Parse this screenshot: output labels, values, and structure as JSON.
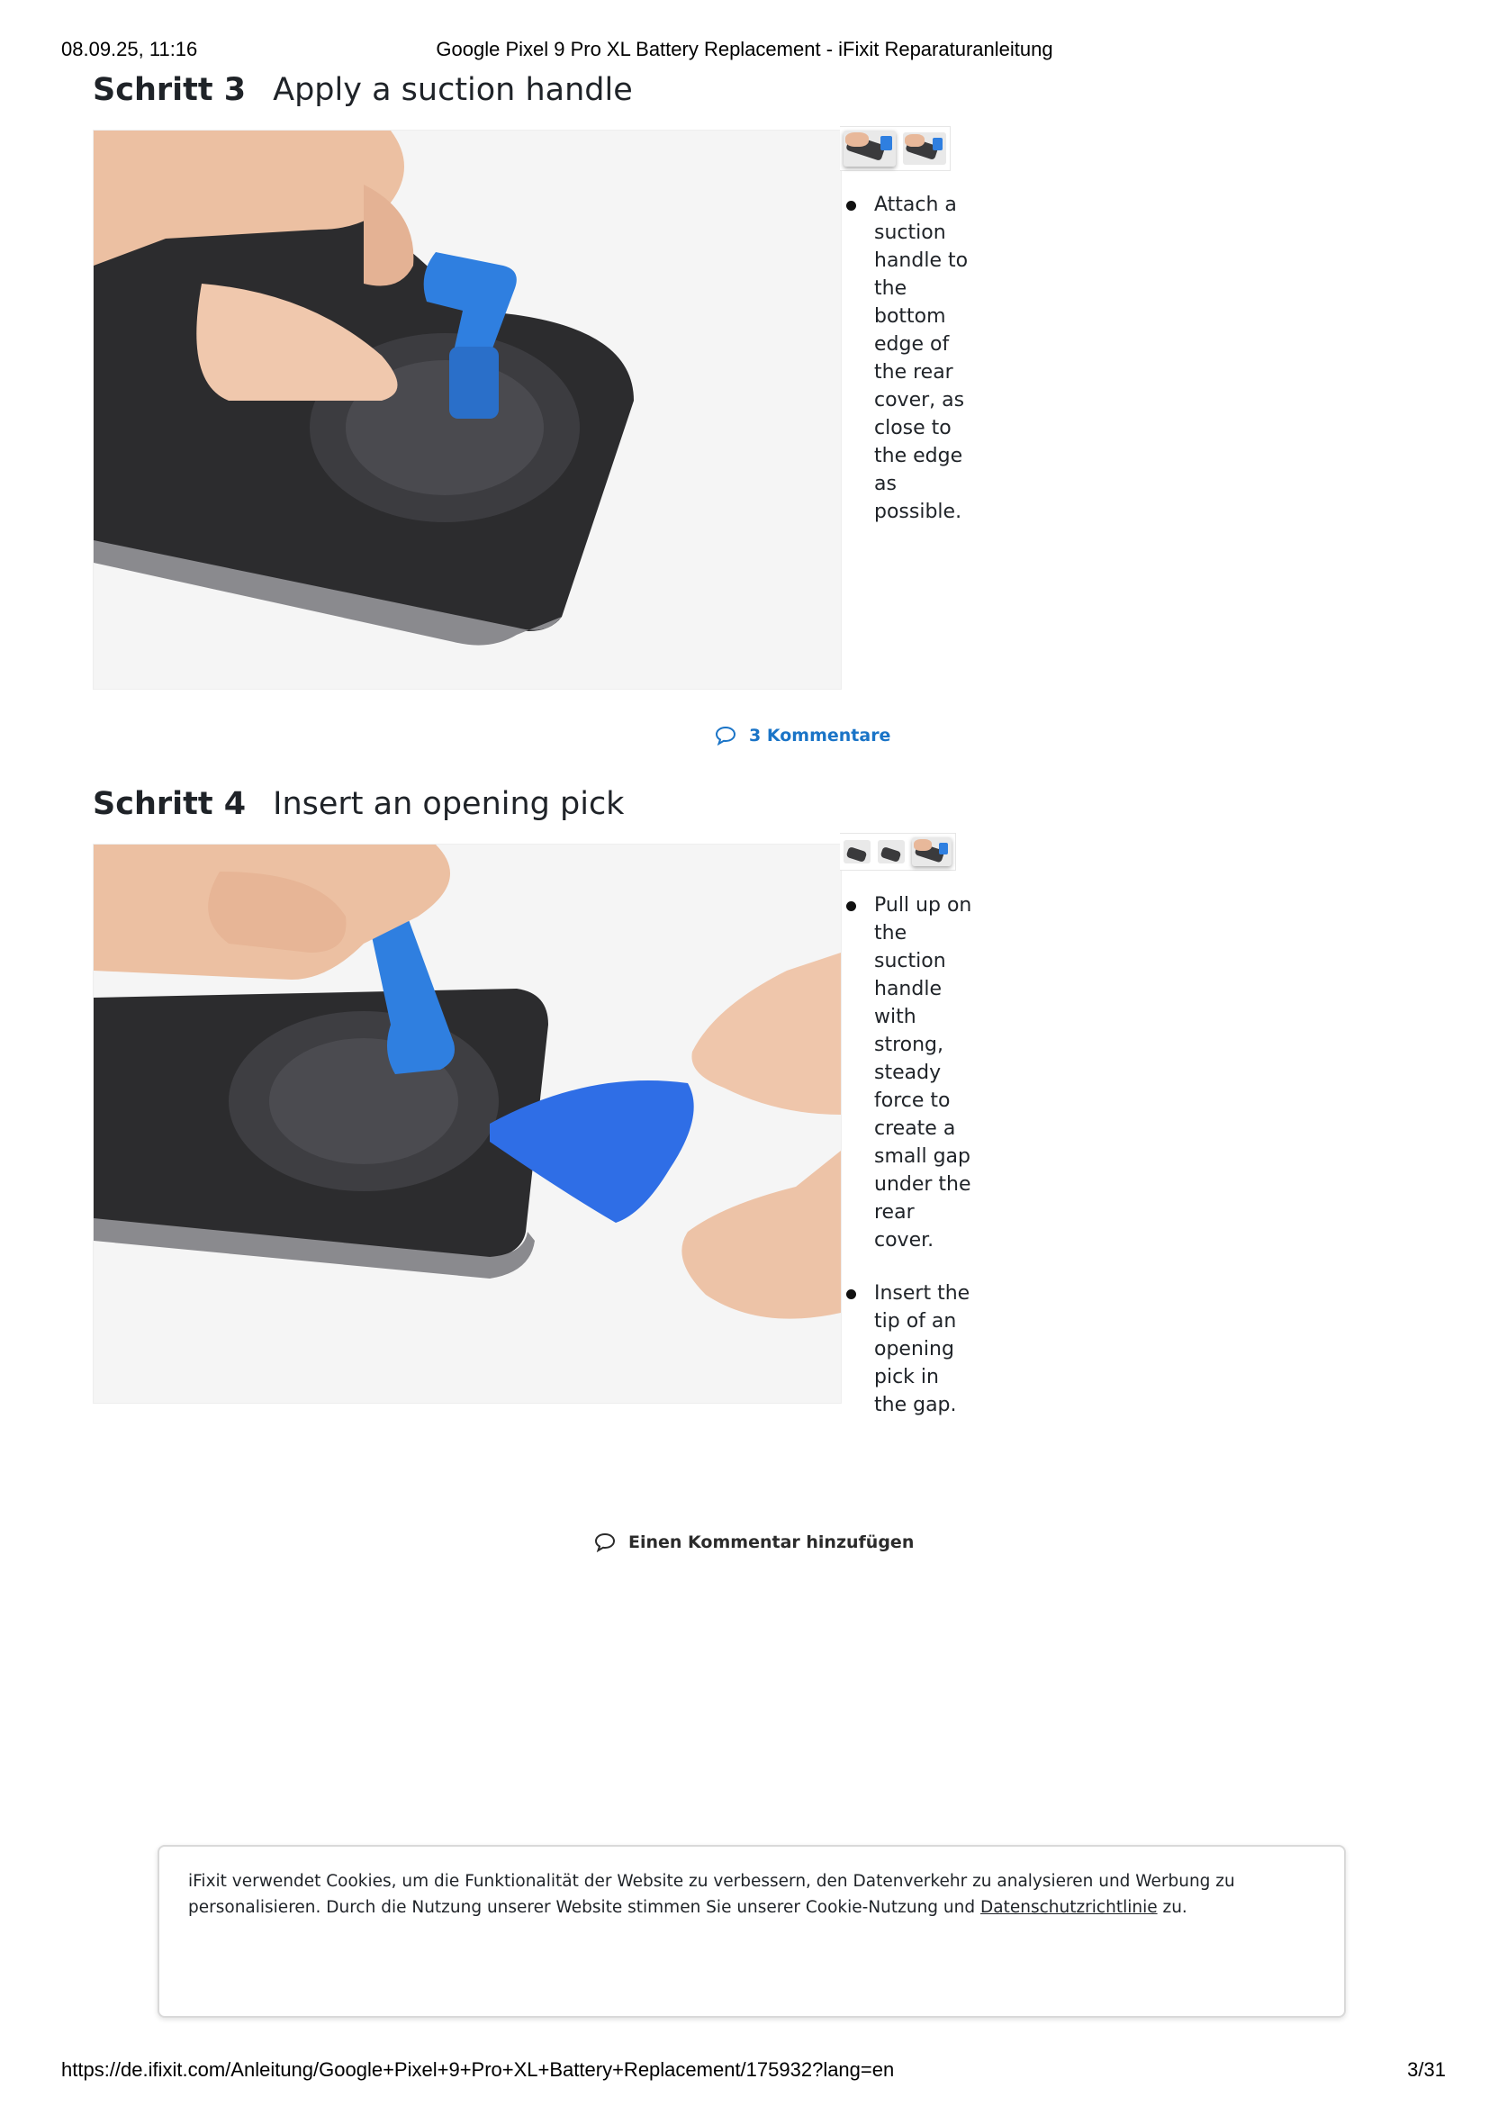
{
  "print_header": {
    "date": "08.09.25, 11:16",
    "title": "Google Pixel 9 Pro XL Battery Replacement - iFixit Reparaturanleitung"
  },
  "steps": [
    {
      "label": "Schritt 3",
      "title": "Apply a suction handle",
      "thumbnail_count": 2,
      "active_thumbnail": 1,
      "bullets": [
        "Attach a suction handle to the bottom edge of the rear cover, as close to the edge as possible."
      ],
      "comments_label": "3 Kommentare"
    },
    {
      "label": "Schritt 4",
      "title": "Insert an opening pick",
      "thumbnail_count": 3,
      "active_thumbnail": 3,
      "bullets": [
        "Pull up on the suction handle with strong, steady force to create a small gap under the rear cover.",
        "Insert the tip of an opening pick in the gap."
      ],
      "comments_label": "Einen Kommentar hinzufügen"
    }
  ],
  "cookie_banner": {
    "text_before_link": "iFixit verwendet Cookies, um die Funktionalität der Website zu verbessern, den Datenverkehr zu analysieren und Werbung zu personalisieren. Durch die Nutzung unserer Website stimmen Sie unserer Cookie-Nutzung und ",
    "link_text": "Datenschutzrichtlinie",
    "text_after_link": " zu."
  },
  "print_footer": {
    "url": "https://de.ifixit.com/Anleitung/Google+Pixel+9+Pro+XL+Battery+Replacement/175932?lang=en",
    "page": "3/31"
  },
  "colors": {
    "link_blue": "#1a74c7",
    "tool_blue": "#2f7fe0",
    "phone_dark": "#2c2c2e"
  }
}
